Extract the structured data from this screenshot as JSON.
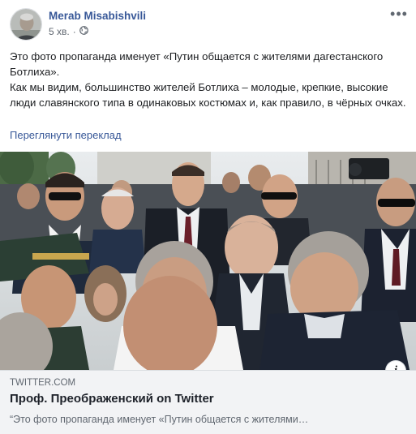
{
  "post": {
    "author": "Merab Misabishvili",
    "time": "5 хв.",
    "separator": "·",
    "privacy_icon": "globe-icon",
    "more_icon": "more-options-icon",
    "text_line1": "Это фото пропаганда именует «Путин общается с жителями дагестанского Ботлиха».",
    "text_line2": "Как мы видим, большинство жителей Ботлиха – молодые, крепкие, высокие люди славянского типа в одинаковых костюмах и, как правило, в чёрных очках.",
    "translate_link": "Переглянути переклад"
  },
  "link_preview": {
    "domain": "TWITTER.COM",
    "title": "Проф. Преображенский on Twitter",
    "description": "“Это фото пропаганда именует «Путин общается с жителями…",
    "info_icon": "info-icon",
    "info_label": "i"
  }
}
